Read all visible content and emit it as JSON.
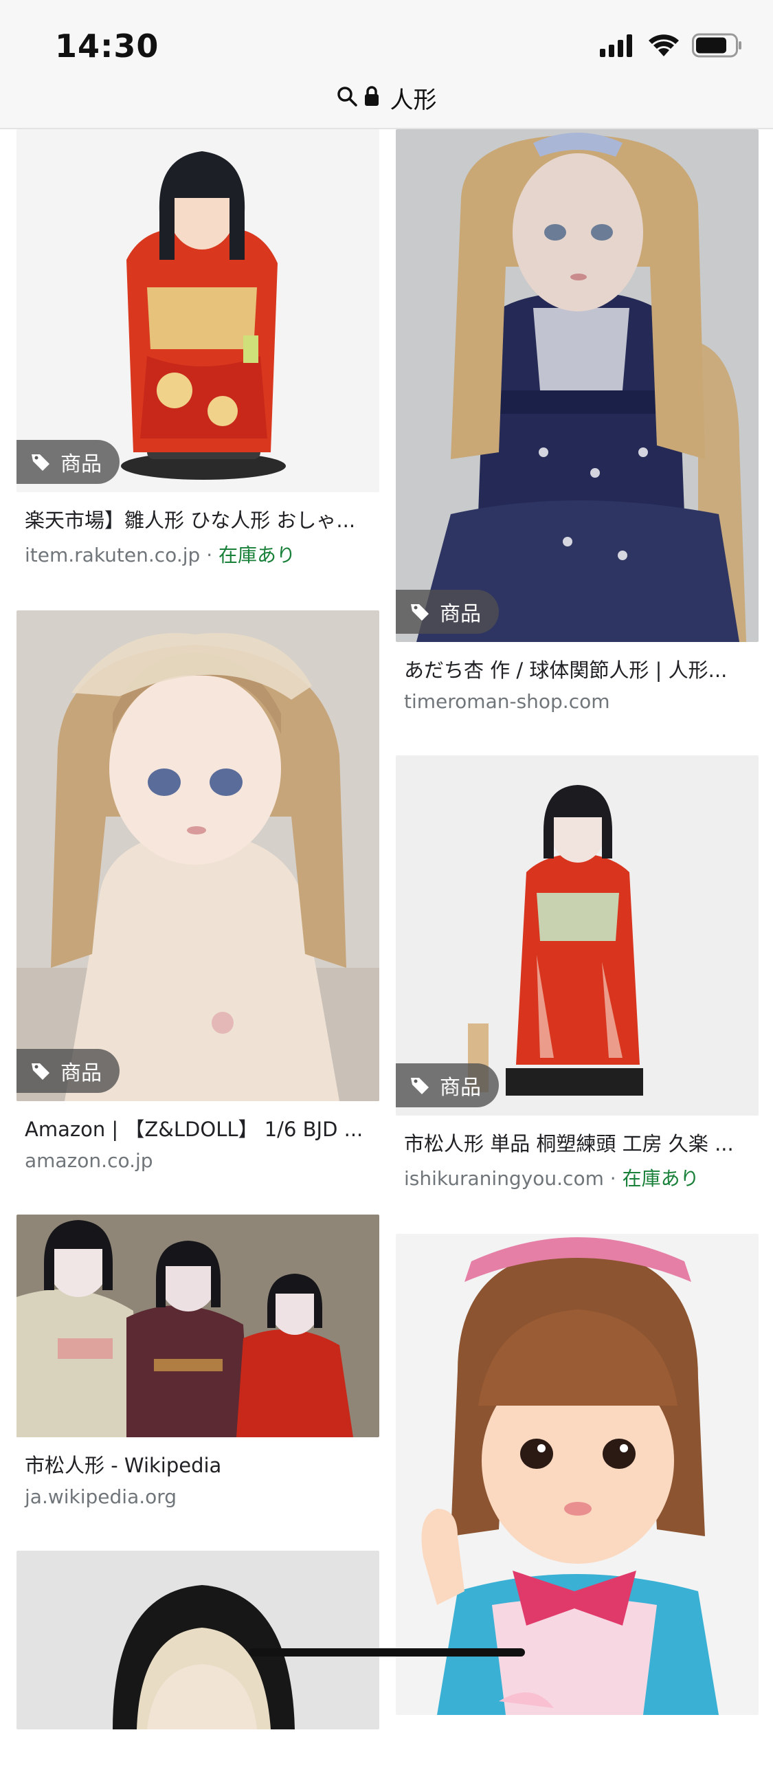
{
  "status_bar": {
    "time": "14:30",
    "icons": [
      "signal-icon",
      "wifi-icon",
      "battery-icon"
    ]
  },
  "url_bar": {
    "query": "人形",
    "icons": [
      "search-icon",
      "lock-icon"
    ]
  },
  "badge_label": "商品",
  "stock_label": "在庫あり",
  "results": {
    "left": [
      {
        "title": "楽天市場】雛人形 ひな人形 おしゃ...",
        "source": "item.rakuten.co.jp",
        "stock": "在庫あり",
        "badge": true
      },
      {
        "title": "Amazon | 【Z&LDOLL】 1/6 BJD ...",
        "source": "amazon.co.jp",
        "badge": true
      },
      {
        "title": "市松人形 - Wikipedia",
        "source": "ja.wikipedia.org",
        "badge": false
      }
    ],
    "right": [
      {
        "title": "あだち杏 作 / 球体関節人形 | 人形...",
        "source": "timeroman-shop.com",
        "badge": true
      },
      {
        "title": "市松人形 単品 桐塑練頭 工房 久楽 ...",
        "source": "ishikuraningyou.com",
        "stock": "在庫あり",
        "badge": true
      }
    ]
  },
  "colors": {
    "stock_green": "#188038",
    "source_gray": "#70757a",
    "badge_bg": "#505050"
  }
}
